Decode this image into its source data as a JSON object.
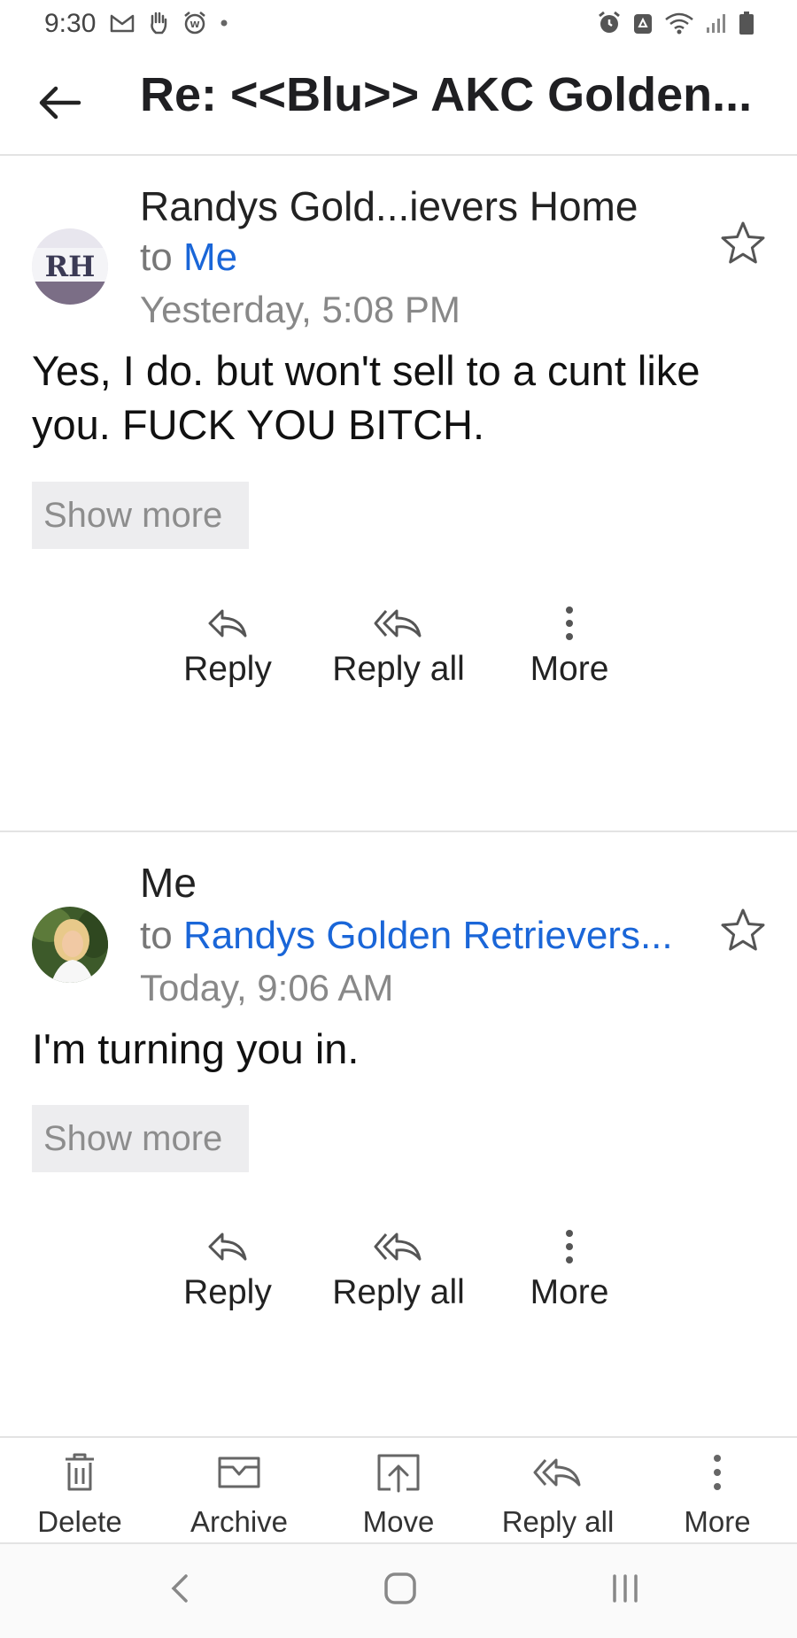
{
  "status_bar": {
    "time": "9:30",
    "left_icons": [
      "gmail-icon",
      "hand-icon",
      "alarm-app-icon",
      "dot-icon"
    ],
    "right_icons": [
      "alarm-icon",
      "recycle-icon",
      "wifi-icon",
      "signal-icon",
      "battery-icon"
    ]
  },
  "header": {
    "subject": "Re: <<Blu>> AKC Golden..."
  },
  "messages": [
    {
      "sender": "Randys Gold...ievers Home",
      "to_prefix": "to",
      "to": "Me",
      "date": "Yesterday, 5:08 PM",
      "avatar_text": "RH",
      "body": "Yes, I do. but won't sell to a cunt like you. FUCK YOU BITCH.",
      "show_more": "Show more",
      "actions": {
        "reply": "Reply",
        "reply_all": "Reply all",
        "more": "More"
      }
    },
    {
      "sender": "Me",
      "to_prefix": "to",
      "to": "Randys Golden Retrievers...",
      "date": "Today, 9:06 AM",
      "body": "I'm turning you in.",
      "show_more": "Show more",
      "actions": {
        "reply": "Reply",
        "reply_all": "Reply all",
        "more": "More"
      }
    }
  ],
  "toolbar": {
    "delete": "Delete",
    "archive": "Archive",
    "move": "Move",
    "reply_all": "Reply all",
    "more": "More"
  },
  "colors": {
    "link_blue": "#1a66d8",
    "divider": "#e3e3e3",
    "show_more_bg": "#ededef"
  }
}
